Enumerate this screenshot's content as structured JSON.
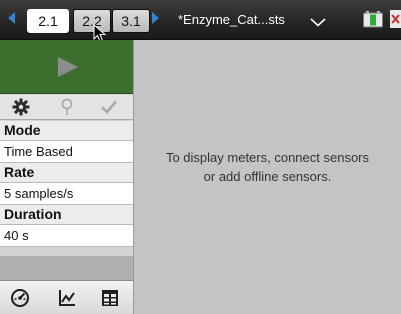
{
  "topbar": {
    "tabs": [
      {
        "label": "2.1",
        "active": true
      },
      {
        "label": "2.2",
        "active": false
      },
      {
        "label": "3.1",
        "active": false
      }
    ],
    "document_title": "*Enzyme_Cat...sts",
    "icons": [
      "arrow-left-icon",
      "arrow-right-icon",
      "chevron-down-icon",
      "battery-icon",
      "close-icon"
    ],
    "accent_color": "#2f86d3"
  },
  "left_panel": {
    "start_button_color": "#3c6e2e",
    "toolbar_icons": [
      "gear-icon",
      "pin-icon",
      "check-icon"
    ],
    "properties": [
      {
        "label": "Mode",
        "value": "Time Based"
      },
      {
        "label": "Rate",
        "value": "5 samples/s"
      },
      {
        "label": "Duration",
        "value": "40 s"
      }
    ],
    "view_icons": [
      "meter-icon",
      "graph-icon",
      "table-icon"
    ]
  },
  "main": {
    "message_line1": "To display meters, connect sensors",
    "message_line2": "or add offline sensors."
  }
}
